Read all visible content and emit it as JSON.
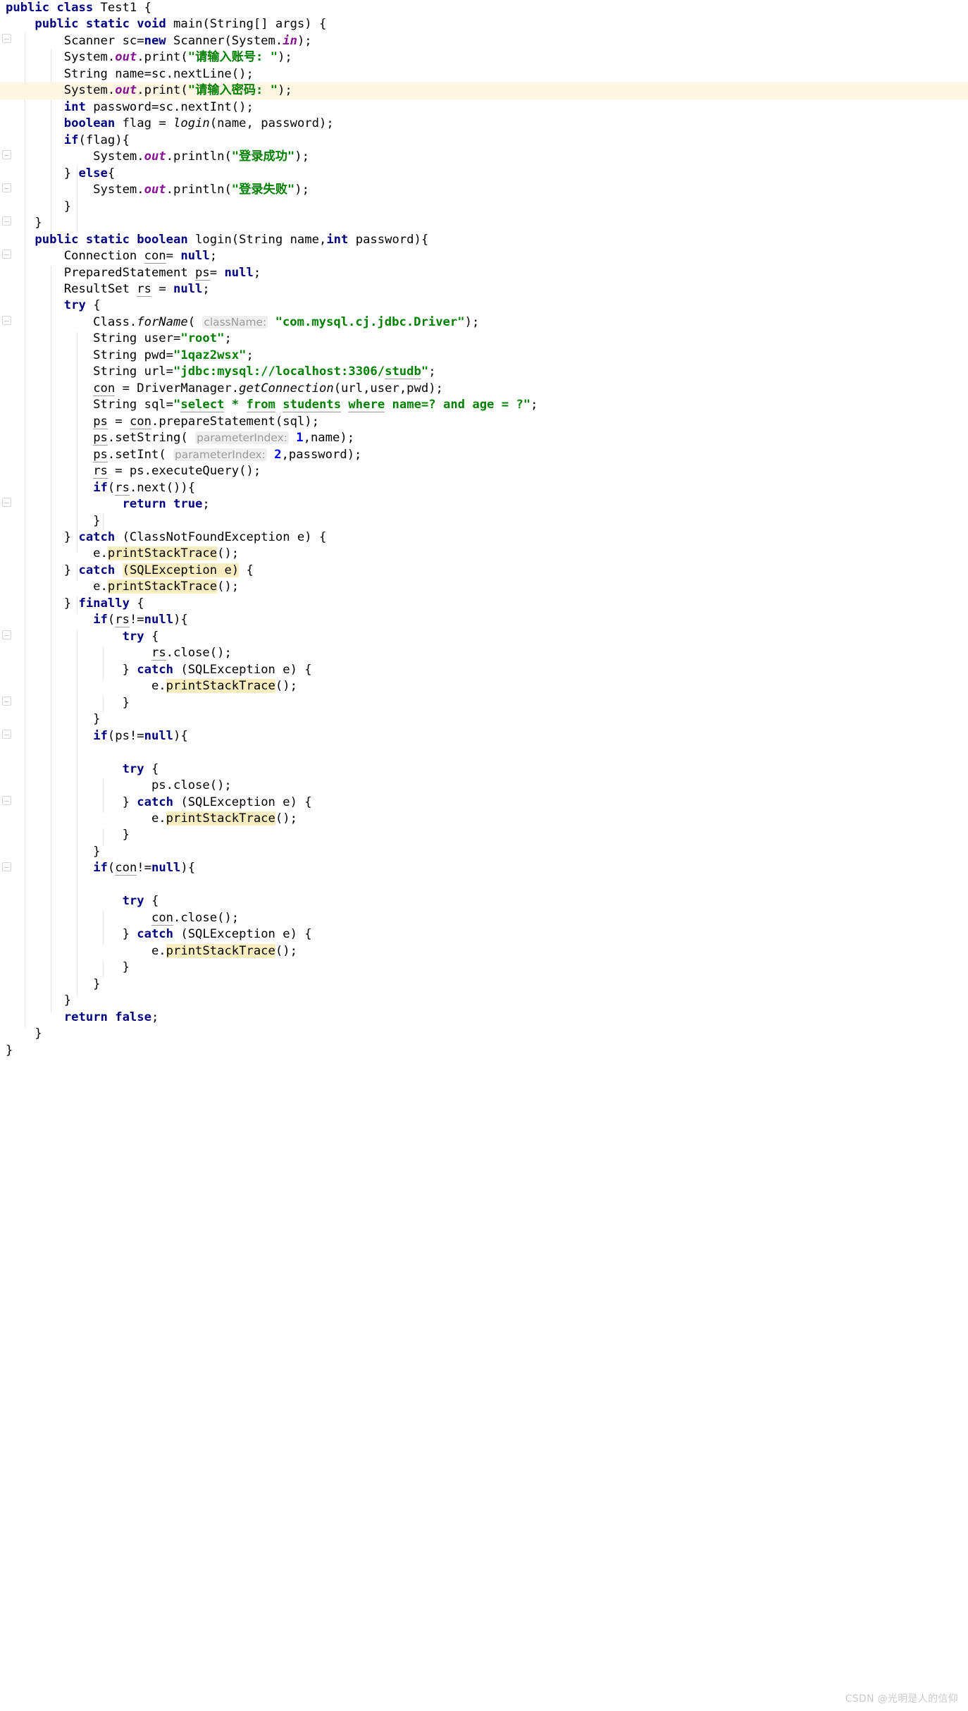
{
  "editor": {
    "language": "Java",
    "class_name": "Test1",
    "colors": {
      "keyword": "#000080",
      "string": "#008000",
      "field": "#871094",
      "number": "#0000ff",
      "hint_text": "#9a9a9a",
      "hint_bg": "#efefef",
      "caret_row_bg": "#fdf6e3",
      "occurrence_bg": "#faeec1",
      "background": "#ffffff",
      "indent_guide": "#e3e3e3"
    },
    "highlighted_lines": [
      5,
      40,
      42
    ],
    "highlighted_occurrences": [
      "printStackTrace",
      "SQLException e"
    ],
    "parameter_hints": [
      {
        "name": "className",
        "line": 25
      },
      {
        "name": "parameterIndex",
        "line": 32,
        "value": "1"
      },
      {
        "name": "parameterIndex",
        "line": 33,
        "value": "2"
      }
    ],
    "strings": {
      "prompt_account": "请输入账号: ",
      "prompt_password": "请输入密码: ",
      "login_success": "登录成功",
      "login_fail": "登录失败",
      "driver_class": "com.mysql.cj.jdbc.Driver",
      "db_user": "root",
      "db_password": "1qaz2wsx",
      "db_url": "jdbc:mysql://localhost:3306/studb",
      "sql_query": "select * from students where name=? and age = ?"
    },
    "code_lines": [
      "public class Test1 {",
      "    public static void main(String[] args) {",
      "        Scanner sc=new Scanner(System.in);",
      "        System.out.print(\"请输入账号: \");",
      "        String name=sc.nextLine();",
      "        System.out.print(\"请输入密码: \");",
      "        int password=sc.nextInt();",
      "        boolean flag = login(name, password);",
      "        if(flag){",
      "            System.out.println(\"登录成功\");",
      "        } else{",
      "            System.out.println(\"登录失败\");",
      "        }",
      "    }",
      "    public static boolean login(String name,int password){",
      "        Connection con= null;",
      "        PreparedStatement ps= null;",
      "        ResultSet rs = null;",
      "        try {",
      "            Class.forName( className: \"com.mysql.cj.jdbc.Driver\");",
      "            String user=\"root\";",
      "            String pwd=\"1qaz2wsx\";",
      "            String url=\"jdbc:mysql://localhost:3306/studb\";",
      "            con = DriverManager.getConnection(url,user,pwd);",
      "            String sql=\"select * from students where name=? and age = ?\";",
      "            ps = con.prepareStatement(sql);",
      "            ps.setString( parameterIndex: 1,name);",
      "            ps.setInt( parameterIndex: 2,password);",
      "            rs = ps.executeQuery();",
      "            if(rs.next()){",
      "                return true;",
      "            }",
      "        } catch (ClassNotFoundException e) {",
      "            e.printStackTrace();",
      "        } catch (SQLException e) {",
      "            e.printStackTrace();",
      "        } finally {",
      "            if(rs!=null){",
      "                try {",
      "                    rs.close();",
      "                } catch (SQLException e) {",
      "                    e.printStackTrace();",
      "                }",
      "            }",
      "            if(ps!=null){",
      "",
      "                try {",
      "                    ps.close();",
      "                } catch (SQLException e) {",
      "                    e.printStackTrace();",
      "                }",
      "            }",
      "            if(con!=null){",
      "",
      "                try {",
      "                    con.close();",
      "                } catch (SQLException e) {",
      "                    e.printStackTrace();",
      "                }",
      "            }",
      "        }",
      "        return false;",
      "    }",
      "}"
    ]
  },
  "watermark": {
    "text": "CSDN @光明是人的信仰"
  }
}
